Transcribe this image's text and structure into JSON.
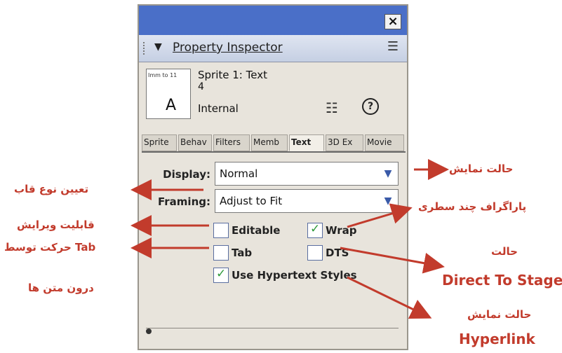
{
  "panel": {
    "close_label": "×",
    "header": {
      "title": "Property Inspector",
      "menu_icon": "options-menu-icon"
    },
    "sprite": {
      "thumb_text": "Imm to 11",
      "title": "Sprite 1: Text",
      "number": "4",
      "cast": "Internal"
    },
    "tabs": [
      "Sprite",
      "Behav",
      "Filters",
      "Memb",
      "Text",
      "3D Ex",
      "Movie"
    ],
    "active_tab": "Text",
    "display": {
      "label": "Display:",
      "value": "Normal"
    },
    "framing": {
      "label": "Framing:",
      "value": "Adjust to Fit"
    },
    "checkboxes": [
      {
        "label": "Editable",
        "checked": false
      },
      {
        "label": "Wrap",
        "checked": true
      },
      {
        "label": "Tab",
        "checked": false
      },
      {
        "label": "DTS",
        "checked": false
      },
      {
        "label": "Use Hypertext Styles",
        "checked": true
      }
    ]
  },
  "annotations": {
    "display_mode": "حالت نمایش",
    "frame_type": "تعیین نوع قاب",
    "editable": "قابلیت ویرایش",
    "wrap": "پاراگراف چند سطری",
    "tab_move": "حرکت توسط Tab",
    "tab_move_2": "درون متن ها",
    "dts_title": "حالت",
    "dts_en": "Direct To Stage",
    "hyperlink_title": "حالت نمایش",
    "hyperlink_en": "Hyperlink"
  },
  "colors": {
    "titlebar": "#4a6fc8",
    "annotation": "#c23b2c",
    "checkmark": "#2f9a3a",
    "panel_bg": "#e8e4dc"
  }
}
